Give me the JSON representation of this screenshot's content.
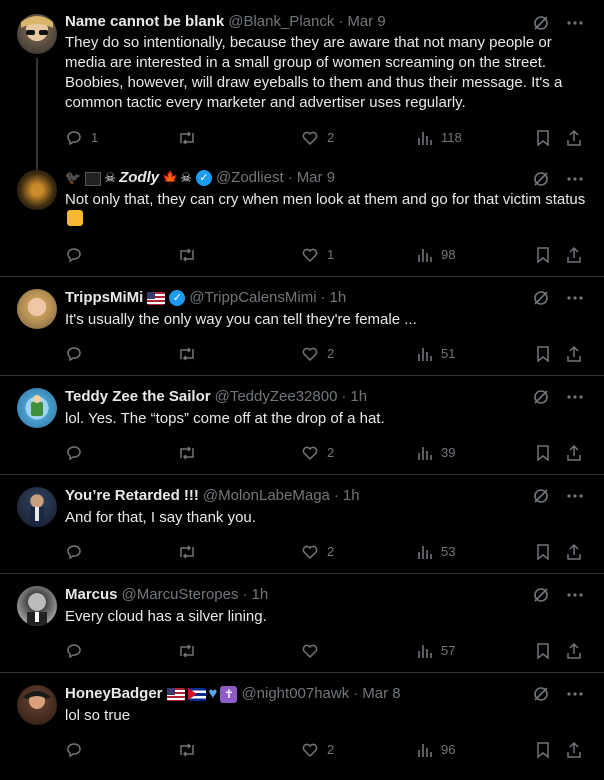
{
  "tweets": [
    {
      "name": "Name cannot be blank",
      "handle": "@Blank_Planck",
      "time": "Mar 9",
      "text": "They do so intentionally, because they are aware that not many people or media are interested in a small group of women screaming on the street. Boobies, however, will draw eyeballs to them and thus their message. It's a common tactic every marketer and advertiser uses regularly.",
      "replies": "1",
      "retweets": "",
      "likes": "2",
      "views": "118"
    },
    {
      "name": "Zodly",
      "handle": "@Zodliest",
      "time": "Mar 9",
      "text": "Not only that, they can cry when men look at them and go for that victim status",
      "replies": "",
      "retweets": "",
      "likes": "1",
      "views": "98"
    },
    {
      "name": "TrippsMiMi",
      "handle": "@TrippCalensMimi",
      "time": "1h",
      "text": "It's usually the only way you can tell they're female ...",
      "replies": "",
      "retweets": "",
      "likes": "2",
      "views": "51"
    },
    {
      "name": "Teddy Zee the Sailor",
      "handle": "@TeddyZee32800",
      "time": "1h",
      "text": "lol. Yes. The “tops” come off at the drop of a hat.",
      "replies": "",
      "retweets": "",
      "likes": "2",
      "views": "39"
    },
    {
      "name": "You’re Retarded !!!",
      "handle": "@MolonLabeMaga",
      "time": "1h",
      "text": "And for that, I say thank you.",
      "replies": "",
      "retweets": "",
      "likes": "2",
      "views": "53"
    },
    {
      "name": "Marcus",
      "handle": "@MarcuSteropes",
      "time": "1h",
      "text": "Every cloud has a silver lining.",
      "replies": "",
      "retweets": "",
      "likes": "",
      "views": "57"
    },
    {
      "name": "HoneyBadger",
      "handle": "@night007hawk",
      "time": "Mar 8",
      "text": "lol so true",
      "replies": "",
      "retweets": "",
      "likes": "2",
      "views": "96"
    }
  ],
  "separator": "·",
  "colors": {
    "background": "#000000",
    "text": "#e7e9ea",
    "muted": "#71767b",
    "border": "#2f3336",
    "verified": "#1d9bf0"
  }
}
